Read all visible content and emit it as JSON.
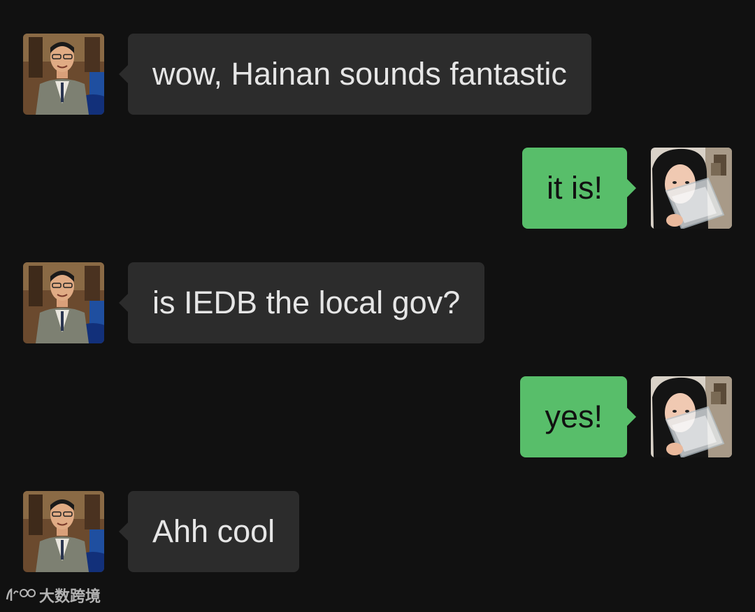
{
  "colors": {
    "background": "#111111",
    "incoming_bubble": "#2c2c2c",
    "outgoing_bubble": "#58be6a"
  },
  "messages": [
    {
      "sender": "contact",
      "avatar": "man-in-suit-avatar",
      "text": "wow, Hainan sounds fantastic"
    },
    {
      "sender": "me",
      "avatar": "woman-holding-glass-avatar",
      "text": "it is!"
    },
    {
      "sender": "contact",
      "avatar": "man-in-suit-avatar",
      "text": "is IEDB the local gov?"
    },
    {
      "sender": "me",
      "avatar": "woman-holding-glass-avatar",
      "text": "yes!"
    },
    {
      "sender": "contact",
      "avatar": "man-in-suit-avatar",
      "text": "Ahh cool"
    }
  ],
  "watermark": {
    "text": "大数跨境"
  }
}
